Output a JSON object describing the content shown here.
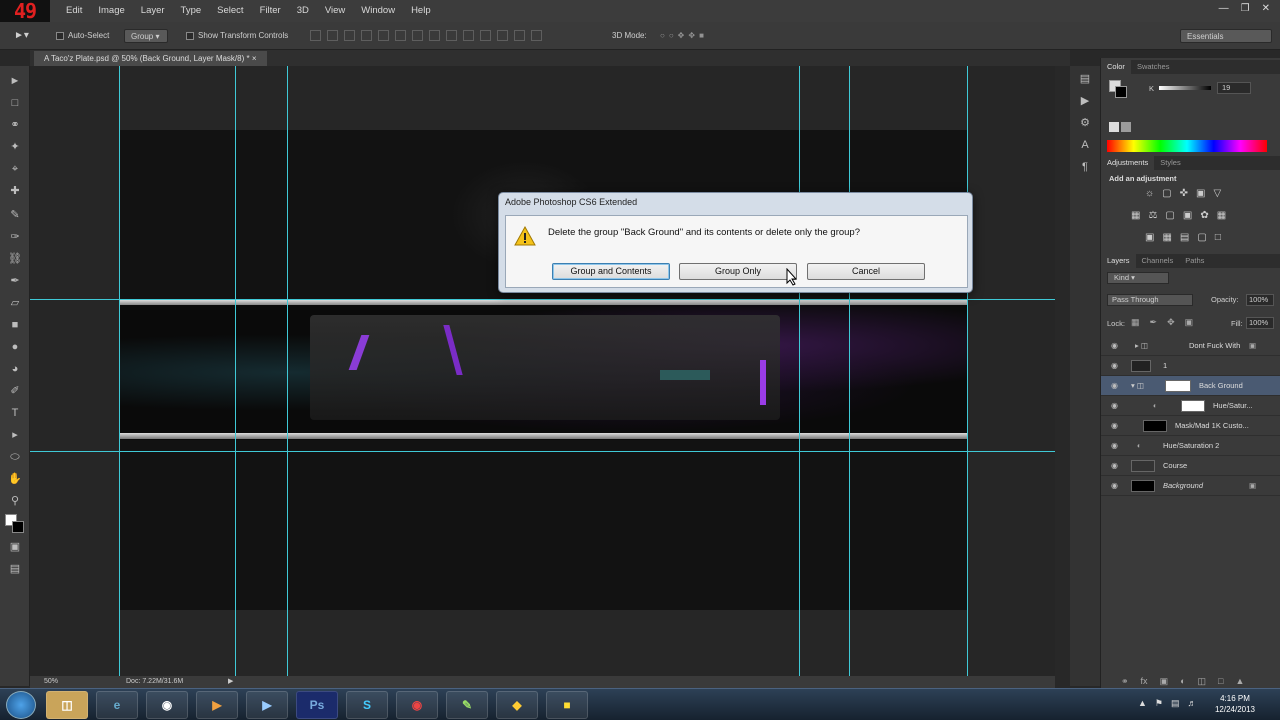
{
  "menubar": {
    "logo": "49",
    "items": [
      "Edit",
      "Image",
      "Layer",
      "Type",
      "Select",
      "Filter",
      "3D",
      "View",
      "Window",
      "Help"
    ]
  },
  "options": {
    "auto_select": "Auto-Select",
    "group_value": "Group",
    "show_transform": "Show Transform Controls",
    "mode_3d": "3D Mode:",
    "workspace": "Essentials"
  },
  "document": {
    "tab_title": "A Taco'z Plate.psd @ 50% (Back Ground, Layer Mask/8) *",
    "zoom": "50%",
    "doc_size": "Doc: 7.22M/31.6M"
  },
  "panels": {
    "color_tabs": [
      "Color",
      "Swatches"
    ],
    "color_k_label": "K",
    "color_k_value": "19",
    "adj_tabs": [
      "Adjustments",
      "Styles"
    ],
    "add_adjustment": "Add an adjustment",
    "layer_tabs": [
      "Layers",
      "Channels",
      "Paths"
    ],
    "kind": "Kind",
    "blend_mode": "Pass Through",
    "opacity_label": "Opacity:",
    "opacity_value": "100%",
    "lock_label": "Lock:",
    "fill_label": "Fill:",
    "fill_value": "100%",
    "layers": [
      "Dont Fuck With",
      "1",
      "Back Ground",
      "Hue/Satur...",
      "Mask/Mad 1K Custo...",
      "Hue/Saturation 2",
      "Course",
      "Background"
    ]
  },
  "dialog": {
    "title": "Adobe Photoshop CS6 Extended",
    "message": "Delete the group \"Back Ground\" and its contents or delete only the group?",
    "btn_group_contents": "Group and Contents",
    "btn_group_only": "Group Only",
    "btn_cancel": "Cancel"
  },
  "taskbar": {
    "time": "4:16 PM",
    "date": "12/24/2013"
  }
}
